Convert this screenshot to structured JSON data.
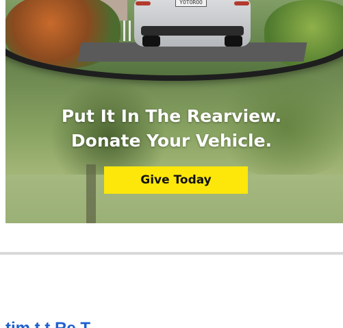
{
  "ad": {
    "plate_text": "YOTOROO",
    "headline_line1": "Put It In The Rearview.",
    "headline_line2": "Donate Your Vehicle.",
    "cta_label": "Give Today",
    "cta_color": "#fde70a"
  },
  "article": {
    "link_text": "tim    t    t Re    T"
  }
}
